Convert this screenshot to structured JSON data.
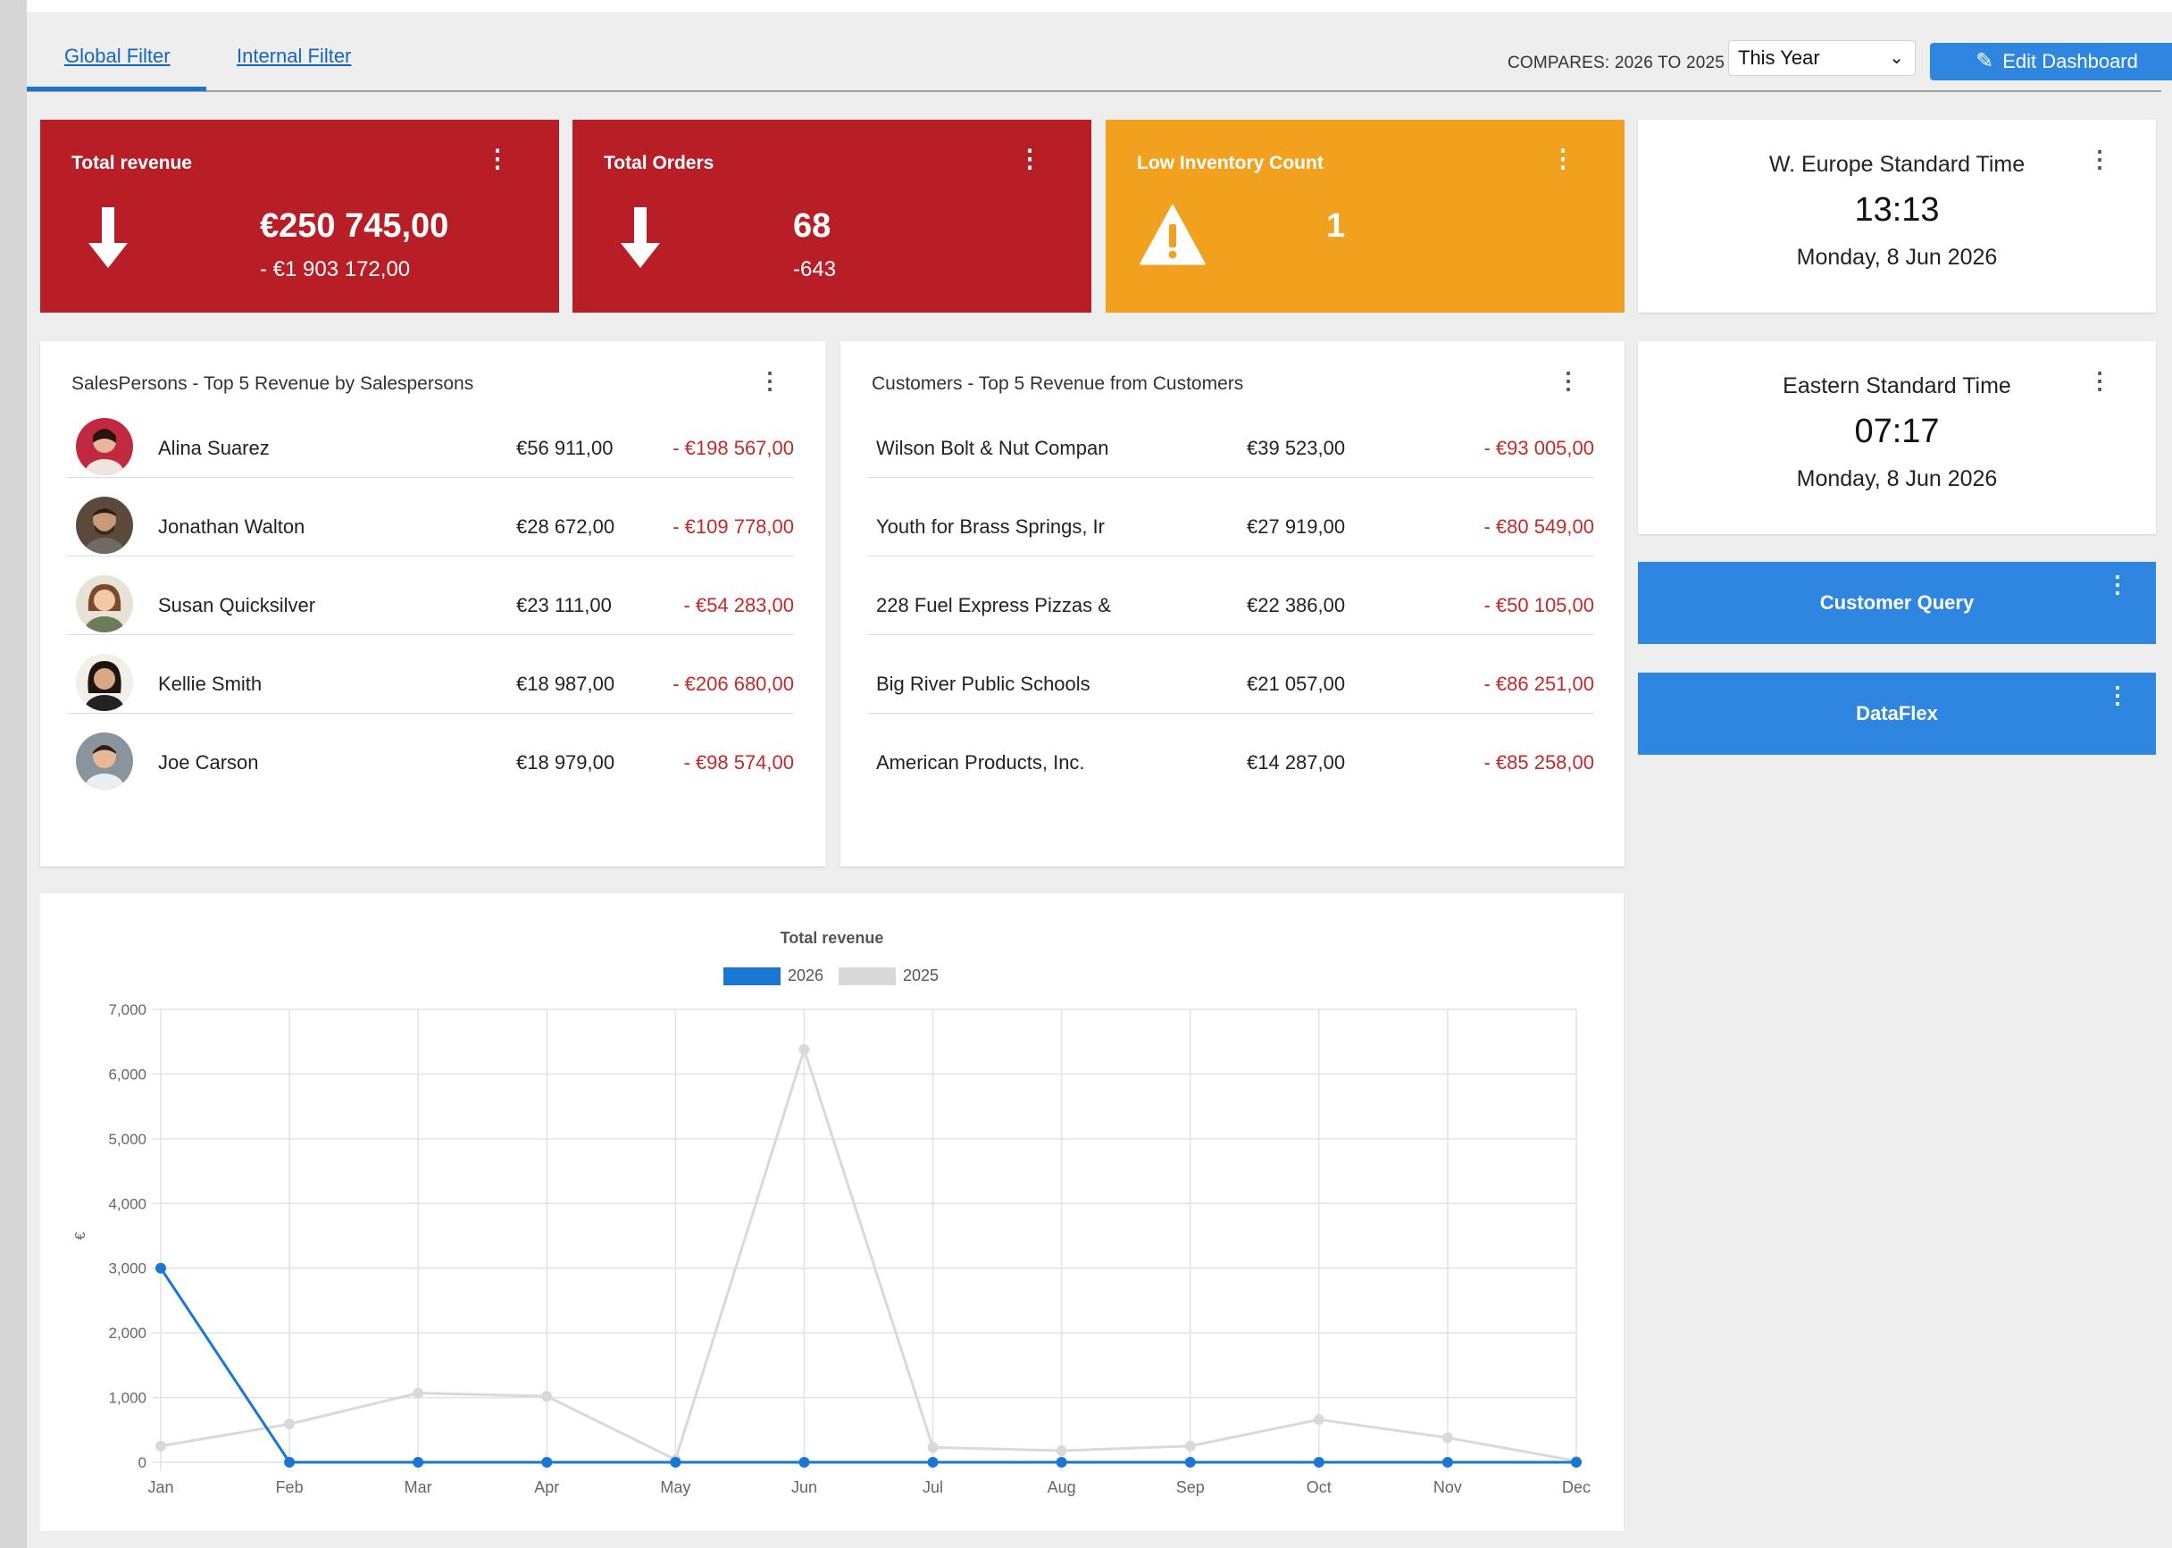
{
  "header": {
    "tabs": [
      "Global Filter",
      "Internal Filter"
    ],
    "compares": "COMPARES: 2026 TO 2025",
    "period_select": "This Year",
    "edit_button": "Edit Dashboard"
  },
  "kpis": [
    {
      "title": "Total revenue",
      "value": "€250 745,00",
      "delta": "- €1 903 172,00",
      "status_color": "#b71e26",
      "icon": "arrow-down-icon"
    },
    {
      "title": "Total Orders",
      "value": "68",
      "delta": "-643",
      "status_color": "#b71e26",
      "icon": "arrow-down-icon"
    },
    {
      "title": "Low Inventory Count",
      "value": "1",
      "status_color": "#f2a11f",
      "icon": "warning-icon"
    }
  ],
  "clocks": [
    {
      "timezone": "W. Europe Standard Time",
      "time": "13:13",
      "date": "Monday, 8 Jun 2026"
    },
    {
      "timezone": "Eastern Standard Time",
      "time": "07:17",
      "date": "Monday, 8 Jun 2026"
    }
  ],
  "salespersons": {
    "title": "SalesPersons - Top 5 Revenue by Salespersons",
    "rows": [
      {
        "name": "Alina Suarez",
        "amount": "€56 911,00",
        "diff": "- €198 567,00"
      },
      {
        "name": "Jonathan Walton",
        "amount": "€28 672,00",
        "diff": "- €109 778,00"
      },
      {
        "name": "Susan Quicksilver",
        "amount": "€23 111,00",
        "diff": "- €54 283,00"
      },
      {
        "name": "Kellie Smith",
        "amount": "€18 987,00",
        "diff": "- €206 680,00"
      },
      {
        "name": "Joe Carson",
        "amount": "€18 979,00",
        "diff": "- €98 574,00"
      }
    ]
  },
  "customers": {
    "title": "Customers - Top 5 Revenue from Customers",
    "rows": [
      {
        "name": "Wilson Bolt & Nut Compan",
        "amount": "€39 523,00",
        "diff": "- €93 005,00"
      },
      {
        "name": "Youth for Brass Springs, Ir",
        "amount": "€27 919,00",
        "diff": "- €80 549,00"
      },
      {
        "name": "228 Fuel Express Pizzas &",
        "amount": "€22 386,00",
        "diff": "- €50 105,00"
      },
      {
        "name": "Big River Public Schools",
        "amount": "€21 057,00",
        "diff": "- €86 251,00"
      },
      {
        "name": "American Products, Inc.",
        "amount": "€14 287,00",
        "diff": "- €85 258,00"
      }
    ]
  },
  "actions": [
    "Customer Query",
    "DataFlex"
  ],
  "colors": {
    "accent": "#2f86e0",
    "negative": "#c62828",
    "series_2026": "#1976d2",
    "series_2025": "#d9d9d9"
  },
  "chart_data": {
    "type": "line",
    "title": "Total revenue",
    "xlabel": "",
    "ylabel": "€",
    "categories": [
      "Jan",
      "Feb",
      "Mar",
      "Apr",
      "May",
      "Jun",
      "Jul",
      "Aug",
      "Sep",
      "Oct",
      "Nov",
      "Dec"
    ],
    "series": [
      {
        "name": "2026",
        "values": [
          3000,
          0,
          0,
          0,
          0,
          0,
          0,
          0,
          0,
          0,
          0,
          0
        ]
      },
      {
        "name": "2025",
        "values": [
          250,
          590,
          1070,
          1020,
          40,
          6380,
          230,
          180,
          250,
          660,
          380,
          20
        ]
      }
    ],
    "ylim": [
      0,
      7000
    ],
    "yticks": [
      "0",
      "1,000",
      "2,000",
      "3,000",
      "4,000",
      "5,000",
      "6,000",
      "7,000"
    ],
    "grid": true,
    "legend": "top"
  }
}
